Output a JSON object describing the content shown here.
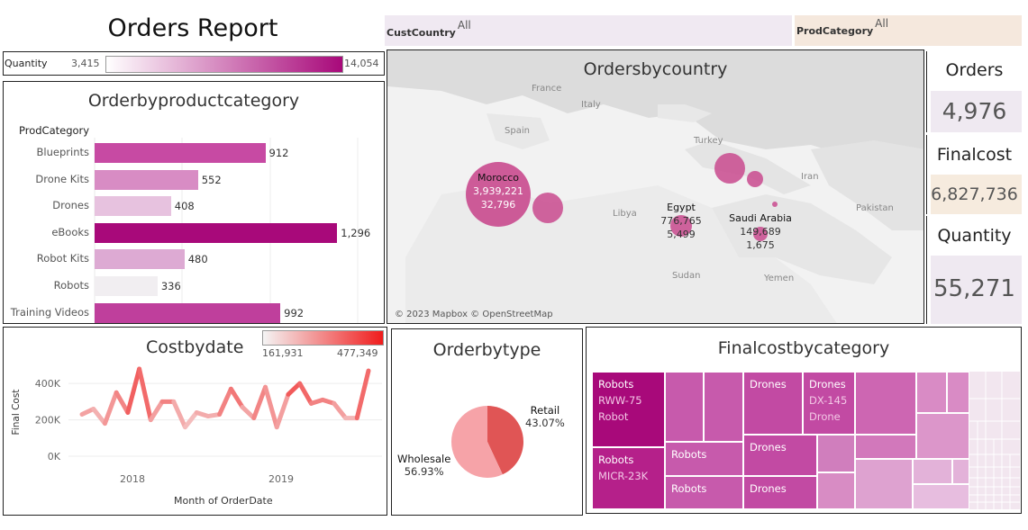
{
  "title": "Orders Report",
  "filters": {
    "cust_country": {
      "label": "CustCountry",
      "value": "All"
    },
    "prod_category": {
      "label": "ProdCategory",
      "value": "All"
    }
  },
  "quantity_legend": {
    "label": "Quantity",
    "min": "3,415",
    "max": "14,054"
  },
  "kpis": [
    {
      "title": "Orders",
      "value": "4,976"
    },
    {
      "title": "Finalcost",
      "value": "6,827,736"
    },
    {
      "title": "Quantity",
      "value": "55,271"
    }
  ],
  "product_chart": {
    "title": "Orderbyproductcategory",
    "header": "ProdCategory",
    "chart_data": {
      "type": "bar",
      "orientation": "horizontal",
      "categories": [
        "Blueprints",
        "Drone Kits",
        "Drones",
        "eBooks",
        "Robot Kits",
        "Robots",
        "Training Videos"
      ],
      "values": [
        912,
        552,
        408,
        1296,
        480,
        336,
        992
      ],
      "value_labels": [
        "912",
        "552",
        "408",
        "1,296",
        "480",
        "336",
        "992"
      ]
    }
  },
  "map": {
    "title": "Ordersbycountry",
    "attribution": "© 2023 Mapbox © OpenStreetMap",
    "geo_labels": [
      "France",
      "Italy",
      "Spain",
      "Turkey",
      "Iran",
      "Libya",
      "Pakistan",
      "Sudan",
      "Yemen"
    ],
    "markers": [
      {
        "country": "Morocco",
        "cost": "3,939,221",
        "quantity": "32,796"
      },
      {
        "country": "Egypt",
        "cost": "776,765",
        "quantity": "5,499"
      },
      {
        "country": "Saudi Arabia",
        "cost": "149,689",
        "quantity": "1,675"
      }
    ]
  },
  "cost_chart": {
    "title": "Costbydate",
    "legend_min": "161,931",
    "legend_max": "477,349",
    "chart_data": {
      "type": "line",
      "xlabel": "Month of OrderDate",
      "ylabel": "Final Cost",
      "y_ticks": [
        "0K",
        "200K",
        "400K"
      ],
      "x_ticks": [
        "2018",
        "2019"
      ],
      "ylim": [
        0,
        480000
      ],
      "values": [
        230000,
        260000,
        180000,
        350000,
        240000,
        480000,
        200000,
        300000,
        300000,
        160000,
        240000,
        220000,
        230000,
        370000,
        270000,
        210000,
        380000,
        160000,
        340000,
        400000,
        290000,
        310000,
        290000,
        210000,
        210000,
        470000
      ]
    }
  },
  "type_chart": {
    "title": "Orderbytype",
    "chart_data": {
      "type": "pie",
      "slices": [
        {
          "label": "Retail",
          "value": 43.07,
          "value_label": "43.07%"
        },
        {
          "label": "Wholesale",
          "value": 56.93,
          "value_label": "56.93%"
        }
      ]
    }
  },
  "treemap": {
    "title": "Finalcostbycategory",
    "labels": {
      "robots_rww": [
        "Robots",
        "RWW-75",
        "Robot"
      ],
      "robots_micr": [
        "Robots",
        "MICR-23K"
      ],
      "robots_a": "Robots",
      "robots_b": "Robots",
      "drones_dx": [
        "Drones",
        "DX-145",
        "Drone"
      ],
      "drones_a": "Drones",
      "drones_b": "Drones",
      "drones_c": "Drones"
    }
  },
  "colors": {
    "magenta_dark": "#a8097a",
    "magenta_mid": "#c94aa5",
    "magenta_light": "#e2a9d2",
    "red_line": "#f01c1c",
    "pie_retail": "#e05555",
    "pie_wholesale": "#f6a3a8"
  }
}
